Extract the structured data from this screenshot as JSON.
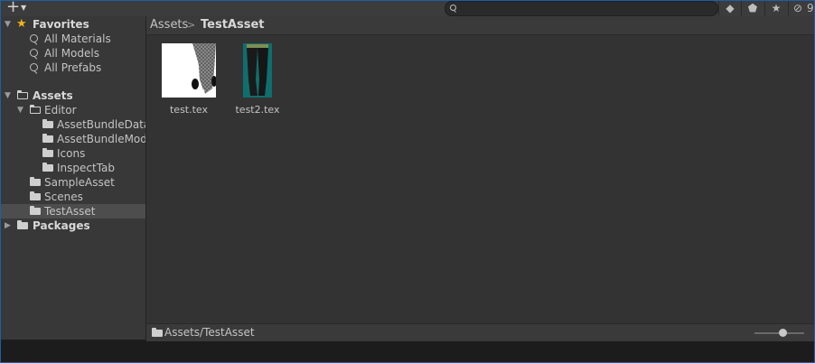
{
  "toolbar": {
    "count": "9"
  },
  "sidebar": {
    "favorites_label": "Favorites",
    "favorites": [
      {
        "label": "All Materials"
      },
      {
        "label": "All Models"
      },
      {
        "label": "All Prefabs"
      }
    ],
    "assets_label": "Assets",
    "editor_label": "Editor",
    "editor_children": [
      {
        "label": "AssetBundleData"
      },
      {
        "label": "AssetBundleMode"
      },
      {
        "label": "Icons"
      },
      {
        "label": "InspectTab"
      }
    ],
    "assets_children": [
      {
        "label": "SampleAsset"
      },
      {
        "label": "Scenes"
      },
      {
        "label": "TestAsset"
      }
    ],
    "packages_label": "Packages"
  },
  "breadcrumb": {
    "root": "Assets",
    "current": "TestAsset"
  },
  "assets": [
    {
      "name": "test.tex"
    },
    {
      "name": "test2.tex"
    }
  ],
  "status": {
    "path": "Assets/TestAsset",
    "zoom": 0.5
  },
  "colors": {
    "selection": "#4d4d4d",
    "accent_star": "#f0b31a",
    "window_border": "#1a5fa8"
  }
}
